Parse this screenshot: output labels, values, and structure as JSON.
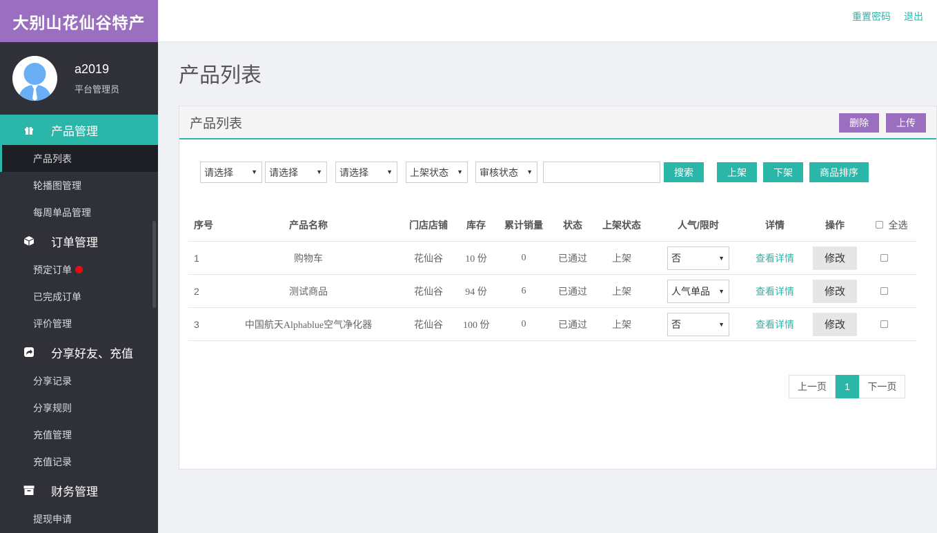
{
  "brand": "大别山花仙谷特产",
  "user": {
    "name": "a2019",
    "role": "平台管理员"
  },
  "nav": {
    "groups": [
      {
        "label": "产品管理",
        "icon": "gift-icon",
        "items": [
          "产品列表",
          "轮播图管理",
          "每周单品管理"
        ]
      },
      {
        "label": "订单管理",
        "icon": "cube-icon",
        "items": [
          "预定订单",
          "已完成订单",
          "评价管理"
        ]
      },
      {
        "label": "分享好友、充值",
        "icon": "share-icon",
        "items": [
          "分享记录",
          "分享规则",
          "充值管理",
          "充值记录"
        ]
      },
      {
        "label": "财务管理",
        "icon": "archive-icon",
        "items": [
          "提现申请"
        ]
      }
    ]
  },
  "top_links": {
    "reset_password": "重置密码",
    "logout": "退出"
  },
  "page_title": "产品列表",
  "panel": {
    "title": "产品列表",
    "delete_label": "删除",
    "upload_label": "上传"
  },
  "filters": {
    "select1": "请选择",
    "select2": "请选择",
    "select3": "请选择",
    "shelf_status": "上架状态",
    "review_status": "审核状态",
    "search_value": "",
    "search_label": "搜索",
    "on_shelf_label": "上架",
    "off_shelf_label": "下架",
    "sort_label": "商品排序"
  },
  "table": {
    "headers": {
      "index": "序号",
      "name": "产品名称",
      "store": "门店店铺",
      "stock": "库存",
      "sales": "累计销量",
      "status": "状态",
      "shelf": "上架状态",
      "popular": "人气/限时",
      "detail": "详情",
      "action": "操作",
      "select_all": "全选"
    },
    "rows": [
      {
        "index": "1",
        "name": "购物车",
        "store": "花仙谷",
        "stock": "10 份",
        "sales": "0",
        "status": "已通过",
        "shelf": "上架",
        "popular": "否",
        "detail": "查看详情",
        "action": "修改"
      },
      {
        "index": "2",
        "name": "测试商品",
        "store": "花仙谷",
        "stock": "94 份",
        "sales": "6",
        "status": "已通过",
        "shelf": "上架",
        "popular": "人气单品",
        "detail": "查看详情",
        "action": "修改"
      },
      {
        "index": "3",
        "name": "中国航天Alphablue空气净化器",
        "store": "花仙谷",
        "stock": "100 份",
        "sales": "0",
        "status": "已通过",
        "shelf": "上架",
        "popular": "否",
        "detail": "查看详情",
        "action": "修改"
      }
    ]
  },
  "pager": {
    "prev": "上一页",
    "current": "1",
    "next": "下一页"
  },
  "colors": {
    "accent": "#2ab7a9",
    "brand": "#9b6fbf",
    "sidebar": "#2f3038",
    "alert": "#ee0a0a"
  }
}
